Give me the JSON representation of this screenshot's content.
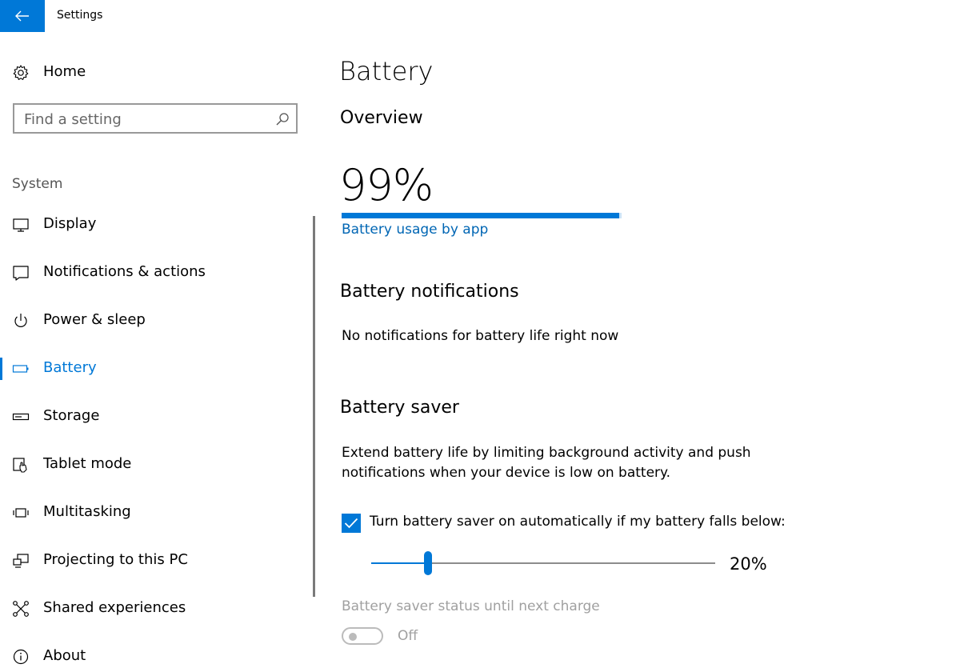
{
  "window": {
    "title": "Settings"
  },
  "sidebar": {
    "home_label": "Home",
    "search_placeholder": "Find a setting",
    "section_label": "System",
    "items": [
      {
        "label": "Display",
        "icon": "monitor-icon"
      },
      {
        "label": "Notifications & actions",
        "icon": "notification-icon"
      },
      {
        "label": "Power & sleep",
        "icon": "power-icon"
      },
      {
        "label": "Battery",
        "icon": "battery-icon",
        "selected": true
      },
      {
        "label": "Storage",
        "icon": "storage-drive-icon"
      },
      {
        "label": "Tablet mode",
        "icon": "tablet-mode-icon"
      },
      {
        "label": "Multitasking",
        "icon": "multitasking-icon"
      },
      {
        "label": "Projecting to this PC",
        "icon": "projector-icon"
      },
      {
        "label": "Shared experiences",
        "icon": "shared-experiences-icon"
      },
      {
        "label": "About",
        "icon": "info-icon"
      }
    ]
  },
  "main": {
    "title": "Battery",
    "overview": {
      "heading": "Overview",
      "percent_text": "99%",
      "percent_value": 99,
      "usage_link": "Battery usage by app"
    },
    "notifications": {
      "heading": "Battery notifications",
      "message": "No notifications for battery life right now"
    },
    "saver": {
      "heading": "Battery saver",
      "description_line1": "Extend battery life by limiting background activity and push",
      "description_line2": "notifications when your device is low on battery.",
      "auto_checkbox_label": "Turn battery saver on automatically if my battery falls below:",
      "auto_checked": true,
      "threshold_value": 20,
      "threshold_text": "20%",
      "status_label": "Battery saver status until next charge",
      "toggle_text": "Off",
      "toggle_on": false
    }
  },
  "colors": {
    "accent": "#0078d7",
    "link": "#0066b4",
    "muted": "#a0a0a0"
  }
}
